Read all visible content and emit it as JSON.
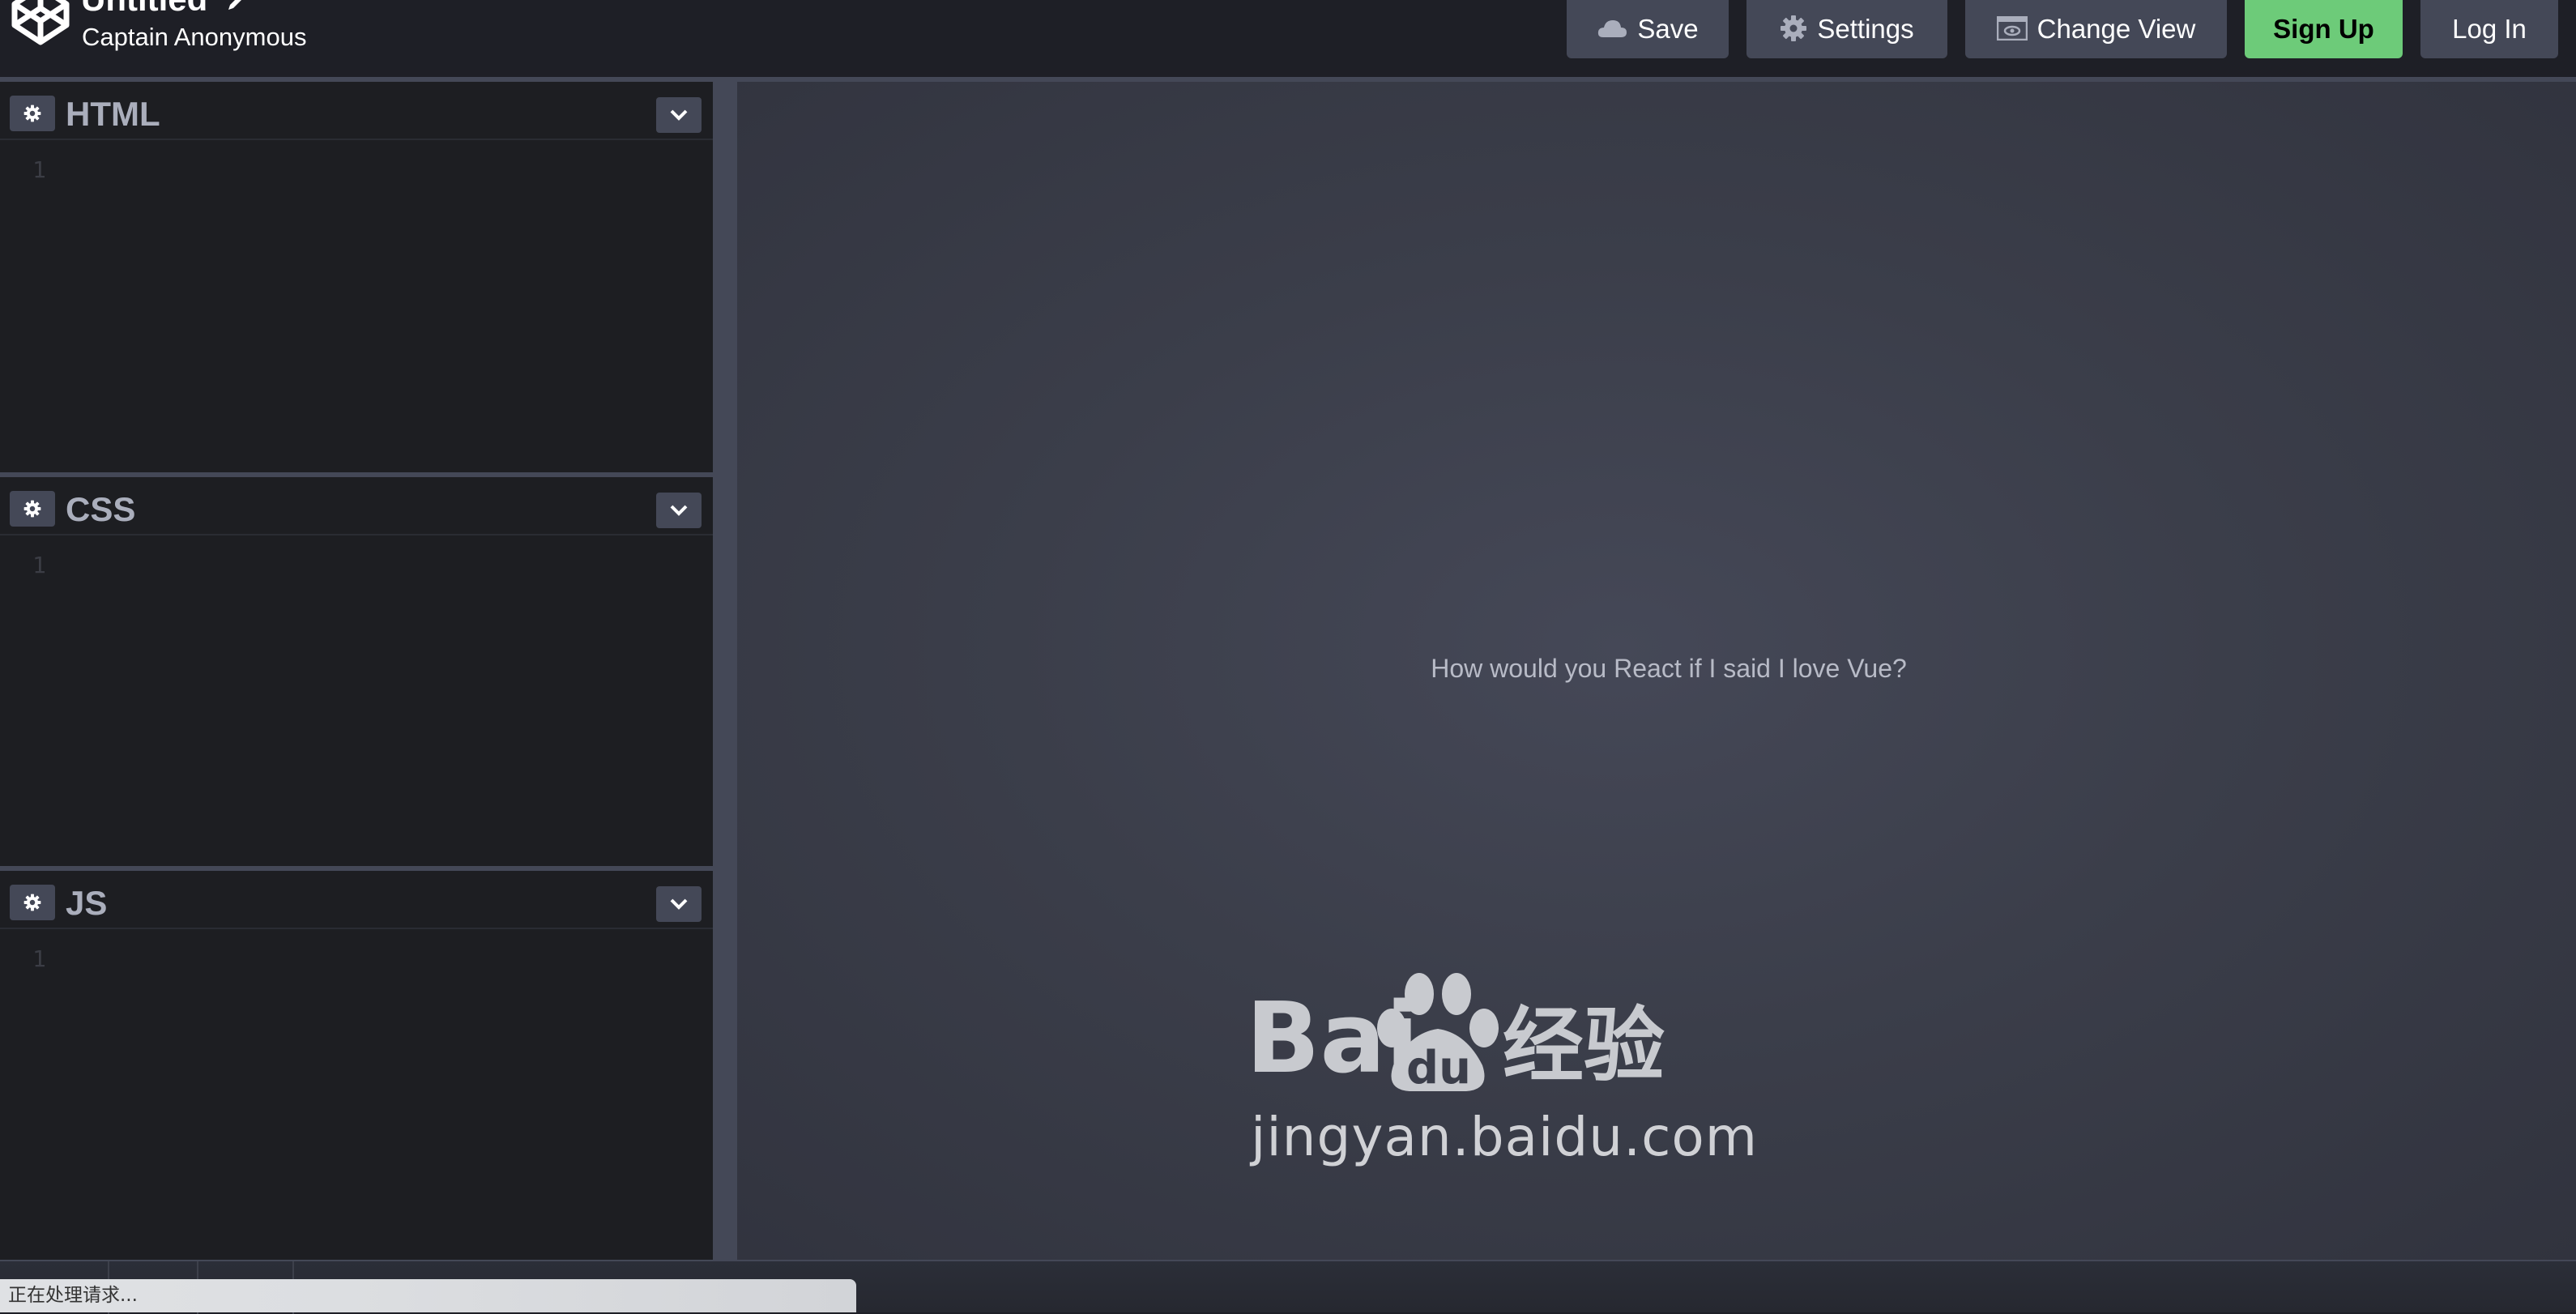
{
  "app": {
    "pen_title": "Untitled",
    "author": "Captain Anonymous",
    "logo_icon": "codepen-cube-icon",
    "edit_title_icon": "pencil-icon"
  },
  "toolbar": {
    "buttons": [
      {
        "id": "save",
        "label": "Save",
        "icon": "cloud-icon"
      },
      {
        "id": "settings",
        "label": "Settings",
        "icon": "gear-icon"
      },
      {
        "id": "change-view",
        "label": "Change View",
        "icon": "view-window-icon"
      },
      {
        "id": "sign-up",
        "label": "Sign Up",
        "color": "#6dcb79"
      },
      {
        "id": "log-in",
        "label": "Log In"
      }
    ]
  },
  "editors": [
    {
      "name": "HTML",
      "line_numbers": [
        "1"
      ],
      "content": ""
    },
    {
      "name": "CSS",
      "line_numbers": [
        "1"
      ],
      "content": ""
    },
    {
      "name": "JS",
      "line_numbers": [
        "1"
      ],
      "content": ""
    }
  ],
  "preview": {
    "text": "How would you React if I said I love Vue?"
  },
  "watermark": {
    "brand": "Bai du 经验",
    "url": "jingyan.baidu.com"
  },
  "status_bar": {
    "message": "正在处理请求..."
  },
  "colors": {
    "background": "#1e1f26",
    "button": "#444857",
    "accent_green": "#6dcb79",
    "editor_bg": "#1d1e22"
  }
}
